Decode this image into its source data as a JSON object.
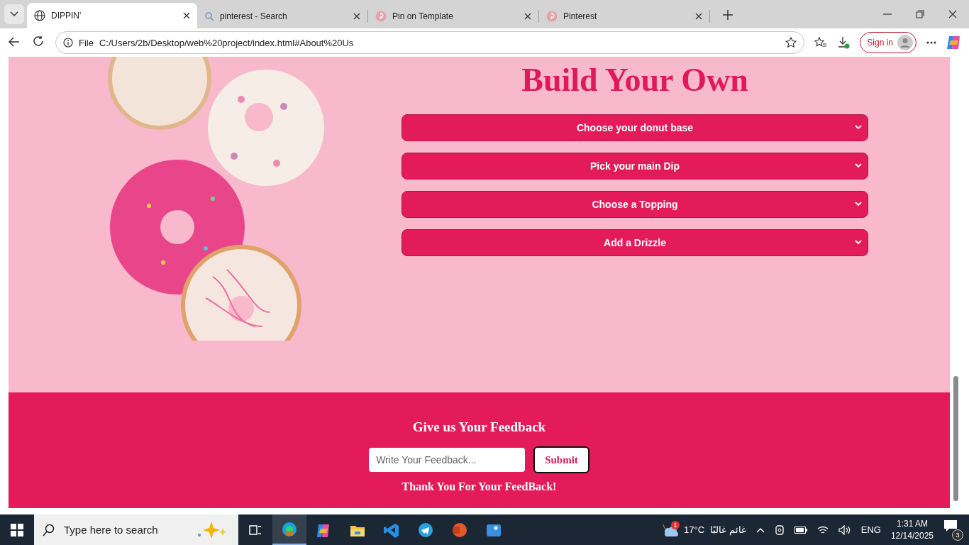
{
  "browser": {
    "tabs": [
      {
        "title": "DIPPIN'",
        "selected": true
      },
      {
        "title": "pinterest - Search",
        "selected": false
      },
      {
        "title": "Pin on Template",
        "selected": false
      },
      {
        "title": "Pinterest",
        "selected": false
      }
    ],
    "address": {
      "scheme": "File",
      "url": "C:/Users/2b/Desktop/web%20project/index.html#About%20Us"
    },
    "sign_in": "Sign in"
  },
  "page": {
    "heading": "Build Your Own",
    "dropdowns": [
      {
        "label": "Choose your donut base"
      },
      {
        "label": "Pick your main Dip"
      },
      {
        "label": "Choose a Topping"
      },
      {
        "label": "Add a Drizzle"
      }
    ],
    "feedback": {
      "title": "Give us Your Feedback",
      "placeholder": "Write Your Feedback...",
      "button": "Submit",
      "thanks": "Thank You For Your FeedBack!"
    }
  },
  "taskbar": {
    "search_placeholder": "Type here to search",
    "apps": [
      {
        "kind": "taskview",
        "active": false
      },
      {
        "kind": "edge",
        "active": true
      },
      {
        "kind": "copilot",
        "active": false
      },
      {
        "kind": "folder",
        "active": false
      },
      {
        "kind": "code",
        "active": false
      },
      {
        "kind": "telegram",
        "active": false
      },
      {
        "kind": "slides",
        "active": false
      },
      {
        "kind": "photos",
        "active": false
      }
    ],
    "weather": {
      "badge": "1",
      "temperature": "17°C",
      "condition": "غائم غالبًا"
    },
    "language": "ENG",
    "time": "1:31 AM",
    "date": "12/14/2025",
    "notifications": "3"
  }
}
